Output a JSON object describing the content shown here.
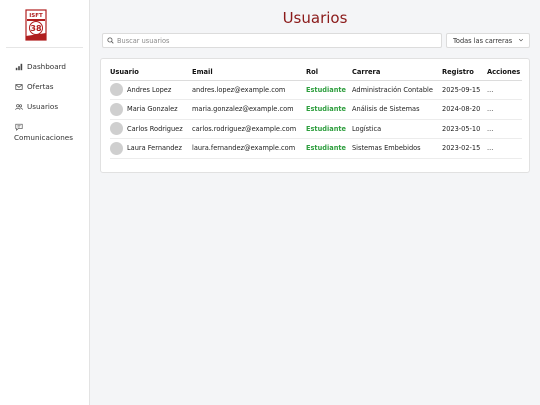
{
  "sidebar": {
    "logo_text": "ISFT 38",
    "items": [
      {
        "label": "Dashboard",
        "icon": "bar-chart-icon"
      },
      {
        "label": "Ofertas",
        "icon": "mail-icon"
      },
      {
        "label": "Usuarios",
        "icon": "users-icon"
      },
      {
        "label": "Comunicaciones",
        "icon": "message-icon"
      }
    ]
  },
  "main": {
    "title": "Usuarios",
    "search": {
      "placeholder": "Buscar usuarios",
      "value": ""
    },
    "filter": {
      "selected": "Todas las carreras"
    },
    "table": {
      "headers": [
        "Usuario",
        "Email",
        "Rol",
        "Carrera",
        "Registro",
        "Acciones"
      ],
      "rows": [
        {
          "name": "Andres Lopez",
          "email": "andres.lopez@example.com",
          "role": "Estudiante",
          "career": "Administración Contable",
          "date": "2025-09-15",
          "actions": "..."
        },
        {
          "name": "Maria Gonzalez",
          "email": "maria.gonzalez@example.com",
          "role": "Estudiante",
          "career": "Análisis de Sistemas",
          "date": "2024-08-20",
          "actions": "..."
        },
        {
          "name": "Carlos Rodriguez",
          "email": "carlos.rodriguez@example.com",
          "role": "Estudiante",
          "career": "Logística",
          "date": "2023-05-10",
          "actions": "..."
        },
        {
          "name": "Laura Fernandez",
          "email": "laura.fernandez@example.com",
          "role": "Estudiante",
          "career": "Sistemas Embebidos",
          "date": "2023-02-15",
          "actions": "..."
        }
      ]
    }
  },
  "colors": {
    "accent": "#8b1a1a",
    "role": "#2e9e3e"
  }
}
